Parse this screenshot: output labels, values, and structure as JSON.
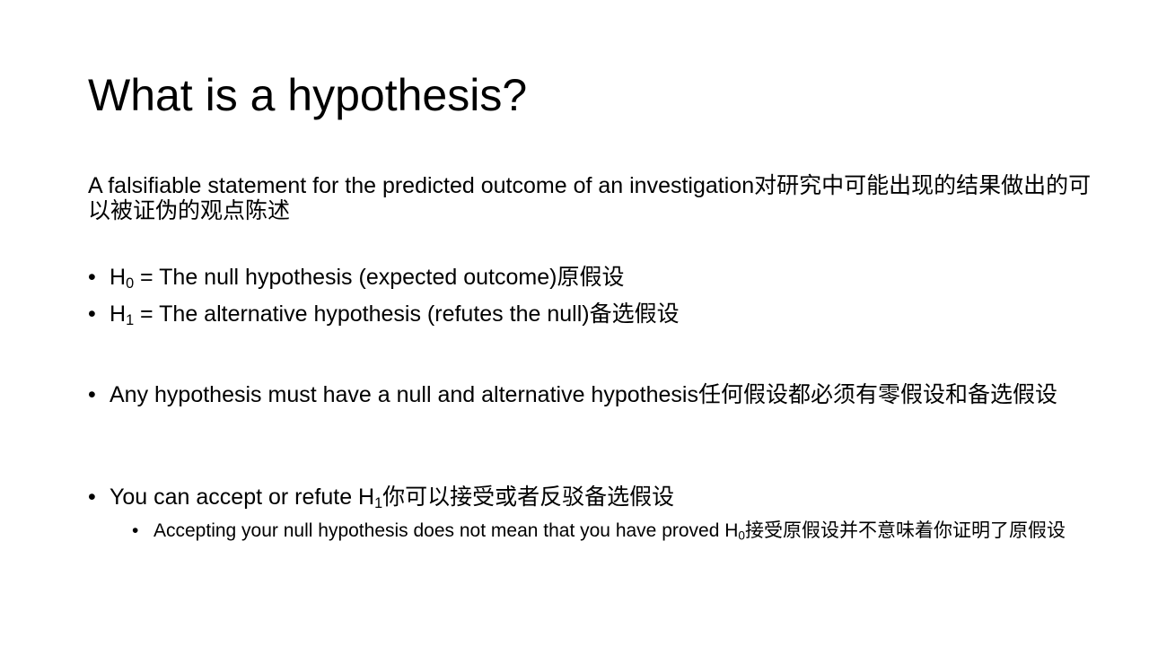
{
  "slide": {
    "title": "What is a hypothesis?",
    "definition": "A falsifiable statement for the predicted outcome of an investigation对研究中可能出现的结果做出的可以被证伪的观点陈述",
    "bullets": {
      "h0": {
        "letter": "H",
        "sub": "0",
        "text": " = The null hypothesis (expected outcome)原假设"
      },
      "h1": {
        "letter": "H",
        "sub": "1",
        "text": " = The alternative hypothesis (refutes the null)备选假设"
      },
      "any": {
        "text": "Any hypothesis must have a null and alternative hypothesis任何假设都必须有零假设和备选假设"
      },
      "you": {
        "text": "You can accept or refute H",
        "sub": "1",
        "after": "你可以接受或者反驳备选假设"
      },
      "accept": {
        "text": "Accepting your null hypothesis does not mean that you have proved H",
        "sub": "0",
        "after": "接受原假设并不意味着你证明了原假设"
      }
    },
    "bullet_glyph": "•"
  }
}
